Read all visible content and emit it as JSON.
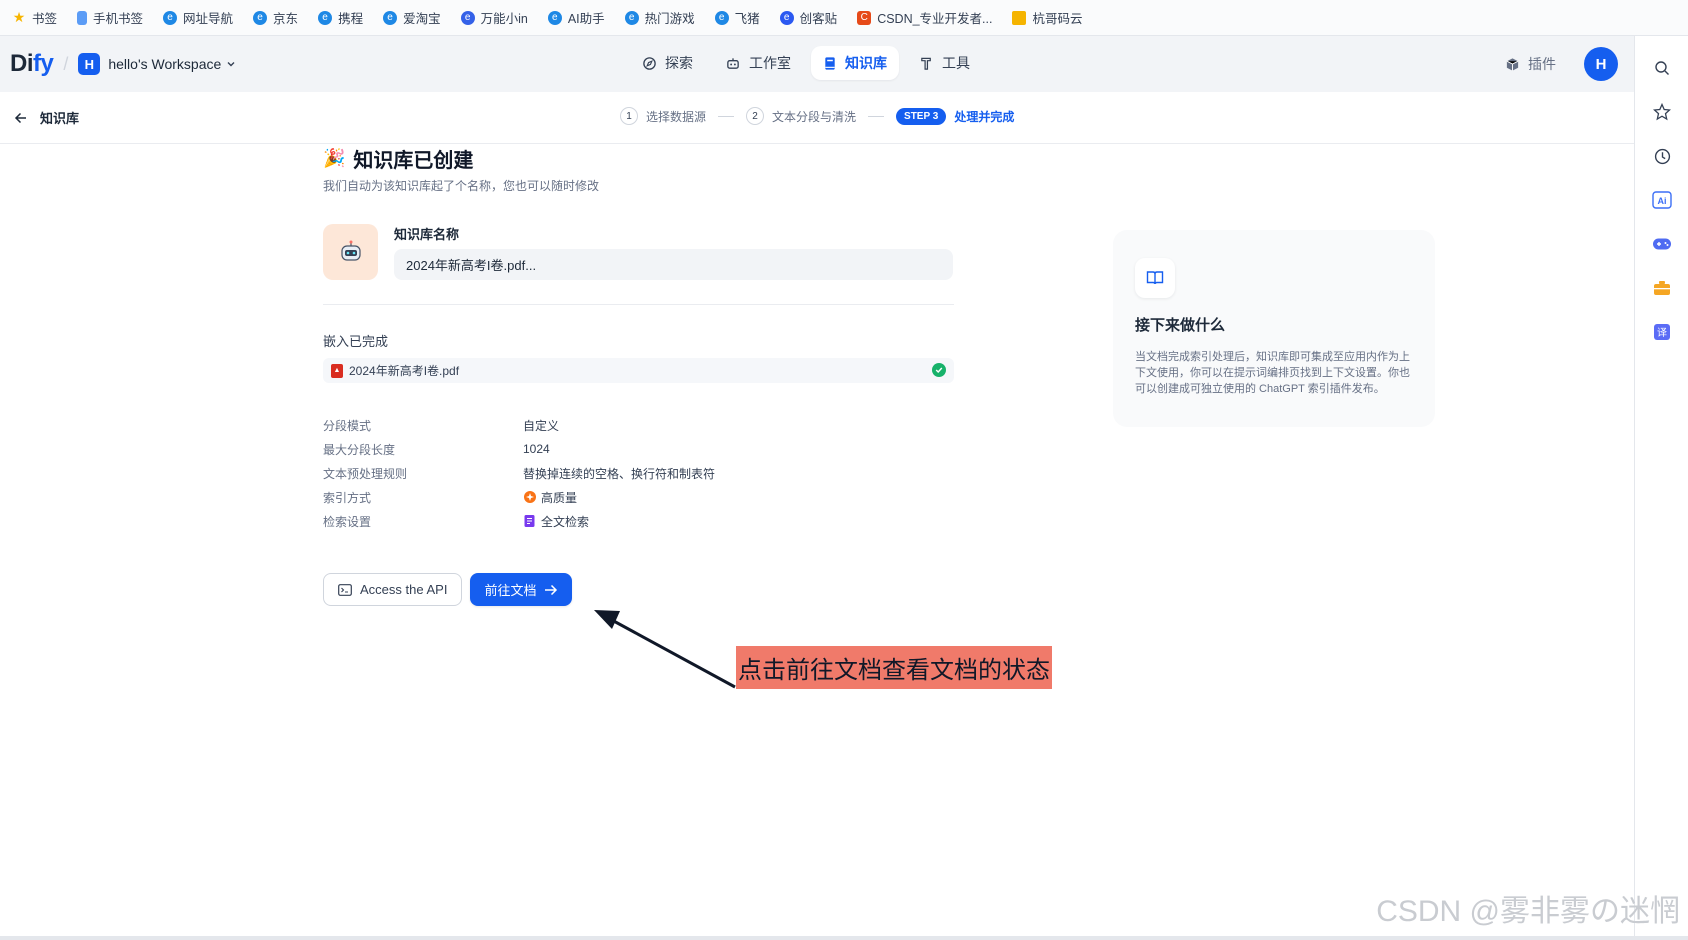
{
  "bookmarks": [
    {
      "label": "书签",
      "icon": "star-icon",
      "color": "#f7b500"
    },
    {
      "label": "手机书签",
      "icon": "phone-icon",
      "color": "#5b9cf6"
    },
    {
      "label": "网址导航",
      "icon": "browser-e-icon",
      "color": "#1e88e5"
    },
    {
      "label": "京东",
      "icon": "browser-e-icon",
      "color": "#1e88e5"
    },
    {
      "label": "携程",
      "icon": "browser-e-icon",
      "color": "#1e88e5"
    },
    {
      "label": "爱淘宝",
      "icon": "browser-e-icon",
      "color": "#1e88e5"
    },
    {
      "label": "万能小in",
      "icon": "robot-icon",
      "color": "#3461e8"
    },
    {
      "label": "AI助手",
      "icon": "browser-e-icon",
      "color": "#1e88e5"
    },
    {
      "label": "热门游戏",
      "icon": "browser-e-icon",
      "color": "#1e88e5"
    },
    {
      "label": "飞猪",
      "icon": "browser-e-icon",
      "color": "#1e88e5"
    },
    {
      "label": "创客贴",
      "icon": "hex-icon",
      "color": "#2b59f1"
    },
    {
      "label": "CSDN_专业开发者...",
      "icon": "csdn-icon",
      "color": "#e64a19"
    },
    {
      "label": "杭哥码云",
      "icon": "folder-icon",
      "color": "#f5b400"
    }
  ],
  "header": {
    "logo_main": "Di",
    "logo_accent": "fy",
    "workspace_initial": "H",
    "workspace_name": "hello's Workspace",
    "nav": [
      {
        "label": "探索",
        "icon": "compass-icon",
        "active": false
      },
      {
        "label": "工作室",
        "icon": "robot-icon",
        "active": false
      },
      {
        "label": "知识库",
        "icon": "book-icon",
        "active": true
      },
      {
        "label": "工具",
        "icon": "hammer-icon",
        "active": false
      }
    ],
    "plugins_label": "插件",
    "user_initial": "H"
  },
  "subheader": {
    "back_label": "知识库",
    "steps": [
      {
        "num": "1",
        "label": "选择数据源"
      },
      {
        "num": "2",
        "label": "文本分段与清洗"
      }
    ],
    "active_step_badge": "STEP 3",
    "active_step_label": "处理并完成"
  },
  "main": {
    "title": "知识库已创建",
    "subtitle": "我们自动为该知识库起了个名称，您也可以随时修改",
    "name_label": "知识库名称",
    "name_value": "2024年新高考I卷.pdf...",
    "embed_title": "嵌入已完成",
    "file_name": "2024年新高考I卷.pdf",
    "info": [
      {
        "label": "分段模式",
        "value": "自定义",
        "icon": ""
      },
      {
        "label": "最大分段长度",
        "value": "1024",
        "icon": ""
      },
      {
        "label": "文本预处理规则",
        "value": "替换掉连续的空格、换行符和制表符",
        "icon": ""
      },
      {
        "label": "索引方式",
        "value": "高质量",
        "icon": "quality-icon"
      },
      {
        "label": "检索设置",
        "value": "全文检索",
        "icon": "fulltext-icon"
      }
    ],
    "api_button": "Access the API",
    "go_button": "前往文档"
  },
  "next_card": {
    "title": "接下来做什么",
    "desc": "当文档完成索引处理后，知识库即可集成至应用内作为上下文使用，你可以在提示词编排页找到上下文设置。你也可以创建成可独立使用的 ChatGPT 索引插件发布。"
  },
  "annotation": "点击前往文档查看文档的状态",
  "watermark": "CSDN @雾非雾の迷惘",
  "colors": {
    "primary": "#155eef",
    "annotation_bg": "#f07a6a",
    "success": "#17b26a"
  }
}
